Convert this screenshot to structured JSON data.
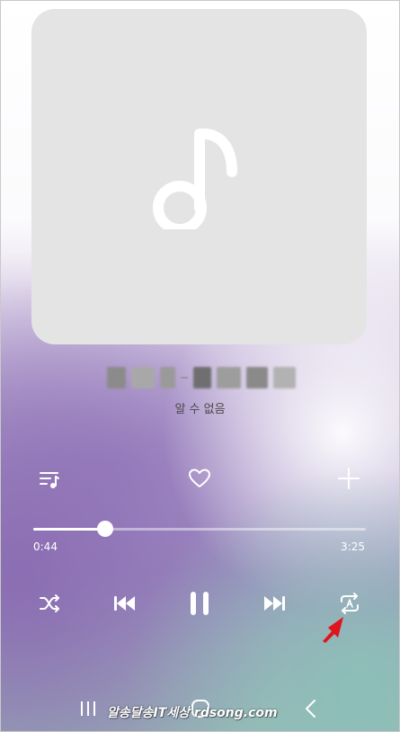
{
  "player": {
    "artist": "알 수 없음",
    "elapsed": "0:44",
    "duration": "3:25",
    "progress_fraction": 0.215,
    "repeat_mode": "repeat-a"
  },
  "watermark": {
    "text": "알송달송IT세상 rdsong.com"
  },
  "icons": {
    "album_placeholder": "music-note-icon",
    "queue": "playlist-icon",
    "favorite": "heart-icon",
    "add": "plus-icon",
    "shuffle": "shuffle-icon",
    "previous": "skip-previous-icon",
    "play_pause": "pause-icon",
    "next": "skip-next-icon",
    "repeat": "repeat-a-icon",
    "nav_recent": "recent-apps-icon",
    "nav_home": "home-icon",
    "nav_back": "back-icon"
  },
  "colors": {
    "accent": "#ffffff",
    "annotation_arrow": "#e0141c",
    "album_bg": "#e4e4e4"
  }
}
